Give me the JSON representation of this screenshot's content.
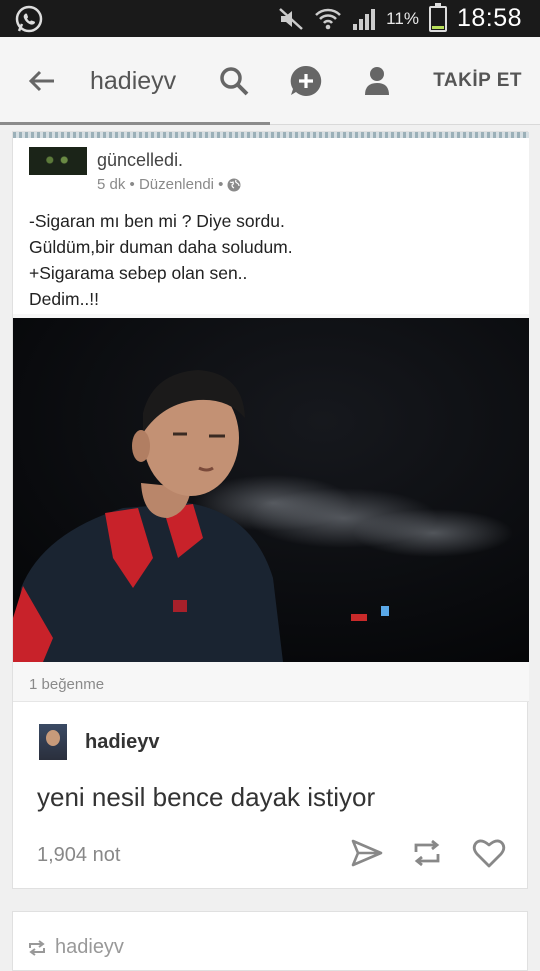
{
  "status_bar": {
    "battery_percent": "11%",
    "battery_level": 0.11,
    "time": "18:58",
    "icons": [
      "whatsapp-icon",
      "mute-icon",
      "wifi-icon",
      "signal-icon",
      "battery-icon"
    ]
  },
  "header": {
    "title": "hadieyv",
    "follow_label": "TAKİP ET",
    "icons": [
      "back-arrow-icon",
      "search-icon",
      "compose-icon",
      "profile-icon"
    ]
  },
  "post": {
    "facebook": {
      "action": "güncelledi.",
      "meta": "5 dk • Düzenlendi •",
      "lines": [
        "-Sigaran mı ben mi ? Diye sordu.",
        "Güldüm,bir duman daha soludum.",
        "+Sigarama sebep olan sen..",
        "Dedim..!!"
      ],
      "likes": "1 beğenme"
    },
    "reblogger": "hadieyv",
    "comment": "yeni nesil bence dayak istiyor",
    "notes": "1,904 not",
    "actions": [
      "share-icon",
      "reblog-icon",
      "like-icon"
    ]
  },
  "next_post": {
    "reblogger": "hadieyv"
  },
  "colors": {
    "status_bar": "#1a1a1a",
    "header_bg": "#f5f5f5",
    "accent_text": "#555555",
    "battery_fill": "#b9e05a"
  }
}
